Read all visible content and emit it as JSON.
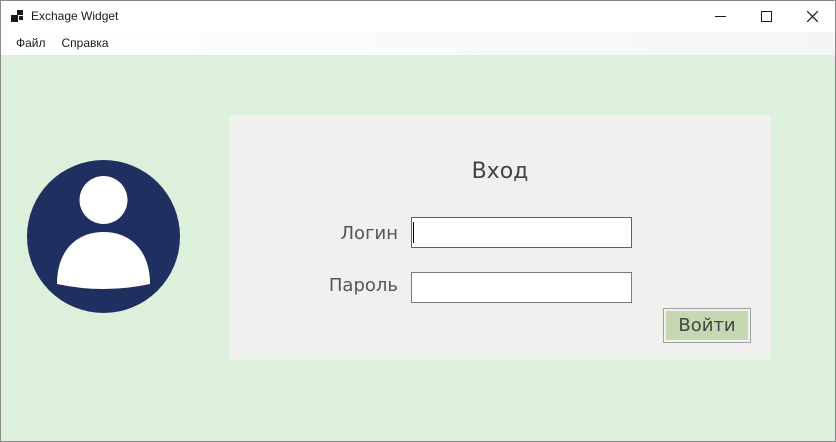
{
  "window": {
    "title": "Exchage Widget",
    "minimize_glyph": "—",
    "maximize_glyph": "☐",
    "close_glyph": "✕"
  },
  "menu": {
    "items": [
      "Файл",
      "Справка"
    ]
  },
  "login": {
    "heading": "Вход",
    "login_label": "Логин",
    "password_label": "Пароль",
    "login_value": "",
    "password_value": "",
    "submit_label": "Войти"
  },
  "colors": {
    "background": "#dcf0dc",
    "panel": "#f0f1ee",
    "avatar": "#1f3060",
    "button": "#c5d8b2",
    "focus_border": "#0078d4"
  },
  "icons": {
    "app": "app-icon",
    "avatar": "user-avatar-icon"
  }
}
